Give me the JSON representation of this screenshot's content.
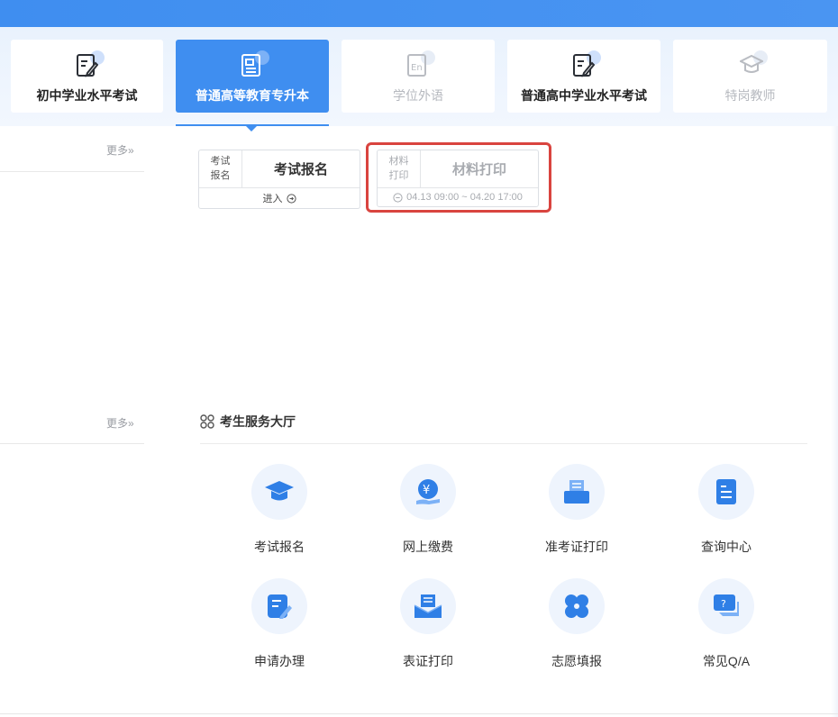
{
  "tabs": [
    {
      "label": "初中学业水平考试",
      "icon": "edit-document-icon",
      "state": "normal"
    },
    {
      "label": "普通高等教育专升本",
      "icon": "document-icon",
      "state": "active"
    },
    {
      "label": "学位外语",
      "icon": "en-language-icon",
      "state": "disabled"
    },
    {
      "label": "普通高中学业水平考试",
      "icon": "edit-document-icon",
      "state": "normal"
    },
    {
      "label": "特岗教师",
      "icon": "graduation-cap-icon",
      "state": "disabled"
    }
  ],
  "left": {
    "more_top": "更多»",
    "more_bottom": "更多»"
  },
  "cards": {
    "signup": {
      "side": [
        "考试",
        "报名"
      ],
      "title": "考试报名",
      "action": "进入"
    },
    "print": {
      "side": [
        "材料",
        "打印"
      ],
      "title": "材料打印",
      "time": "04.13 09:00 ~ 04.20 17:00"
    }
  },
  "services": {
    "title": "考生服务大厅",
    "items": [
      {
        "label": "考试报名",
        "icon": "graduation-cap-icon"
      },
      {
        "label": "网上缴费",
        "icon": "yuan-payment-icon"
      },
      {
        "label": "准考证打印",
        "icon": "printer-icon"
      },
      {
        "label": "查询中心",
        "icon": "document-search-icon"
      },
      {
        "label": "申请办理",
        "icon": "edit-form-icon"
      },
      {
        "label": "表证打印",
        "icon": "envelope-print-icon"
      },
      {
        "label": "志愿填报",
        "icon": "clover-icon"
      },
      {
        "label": "常见Q/A",
        "icon": "question-chat-icon"
      }
    ]
  },
  "colors": {
    "brand": "#3f8ef0",
    "highlight": "#d9443f"
  }
}
